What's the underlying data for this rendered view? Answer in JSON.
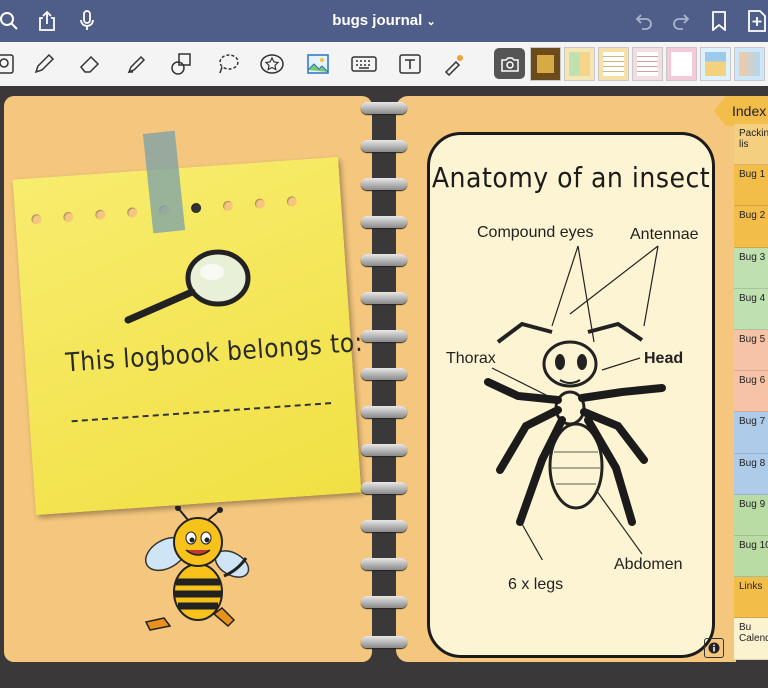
{
  "header": {
    "title": "bugs journal",
    "title_caret": "⌄",
    "icons": [
      "search-icon",
      "share-icon",
      "microphone-icon",
      "undo-icon",
      "redo-icon",
      "bookmark-icon",
      "add-page-icon"
    ]
  },
  "toolbar": {
    "tools": [
      "zoom-icon",
      "pen-icon",
      "eraser-icon",
      "highlighter-icon",
      "shapes-icon",
      "lasso-icon",
      "sticker-icon",
      "image-icon",
      "keyboard-icon",
      "text-icon",
      "laser-icon",
      "camera-icon"
    ],
    "thumbnail_count": 7
  },
  "left_page": {
    "belongs_text": "This logbook belongs to:"
  },
  "right_page": {
    "card_title": "Anatomy of an insect",
    "labels": {
      "compound_eyes": "Compound eyes",
      "antennae": "Antennae",
      "thorax": "Thorax",
      "head": "Head",
      "abdomen": "Abdomen",
      "legs": "6 x legs"
    }
  },
  "index_tab": "Index",
  "tabs": [
    {
      "label": "Packin lis",
      "color": "#f5cf80"
    },
    {
      "label": "Bug 1",
      "color": "#f3bd49"
    },
    {
      "label": "Bug 2",
      "color": "#f3bd49"
    },
    {
      "label": "Bug 3",
      "color": "#bfe0b0"
    },
    {
      "label": "Bug 4",
      "color": "#bfe0b0"
    },
    {
      "label": "Bug 5",
      "color": "#f6c3a6"
    },
    {
      "label": "Bug 6",
      "color": "#f6c3a6"
    },
    {
      "label": "Bug 7",
      "color": "#aecbea"
    },
    {
      "label": "Bug 8",
      "color": "#aecbea"
    },
    {
      "label": "Bug 9",
      "color": "#b8dca4"
    },
    {
      "label": "Bug 10",
      "color": "#b8dca4"
    },
    {
      "label": "Links",
      "color": "#f3bd49"
    },
    {
      "label": "Bu Calenda",
      "color": "#fbf2cf"
    }
  ],
  "colors": {
    "topbar": "#4e5e88",
    "page": "#f5c77e",
    "desk": "#3a3838"
  }
}
